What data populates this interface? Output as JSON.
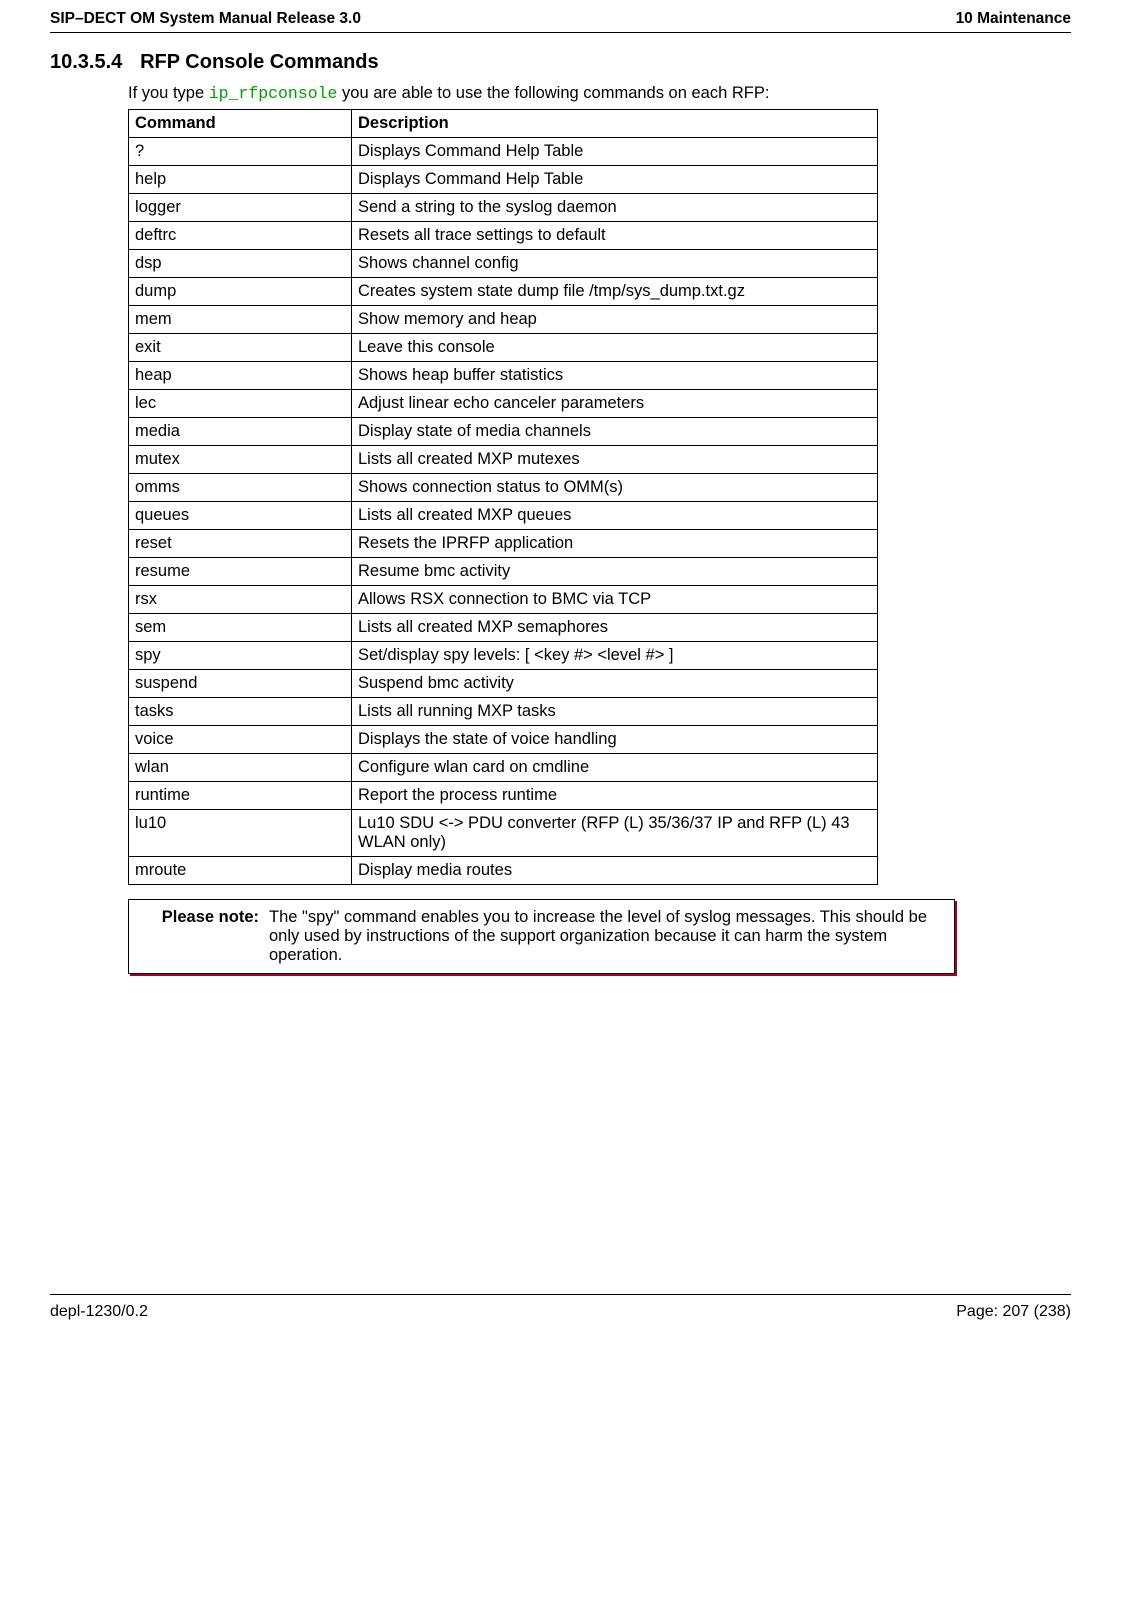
{
  "header": {
    "left": "SIP–DECT OM System Manual Release 3.0",
    "right": "10 Maintenance"
  },
  "section": {
    "number": "10.3.5.4",
    "title": "RFP Console Commands"
  },
  "intro": {
    "prefix": "If you type ",
    "code": "ip_rfpconsole",
    "suffix": " you are able to use the following commands on each RFP:"
  },
  "table": {
    "headers": {
      "c1": "Command",
      "c2": "Description"
    },
    "rows": [
      {
        "cmd": "?",
        "desc": "Displays Command Help Table"
      },
      {
        "cmd": "help",
        "desc": "Displays Command Help Table"
      },
      {
        "cmd": "logger",
        "desc": "Send a string to the syslog daemon"
      },
      {
        "cmd": "deftrc",
        "desc": "Resets all trace settings to default"
      },
      {
        "cmd": "dsp",
        "desc": "Shows channel config"
      },
      {
        "cmd": "dump",
        "desc": "Creates system state dump file /tmp/sys_dump.txt.gz"
      },
      {
        "cmd": "mem",
        "desc": "Show memory and heap"
      },
      {
        "cmd": "exit",
        "desc": "Leave this console"
      },
      {
        "cmd": "heap",
        "desc": "Shows heap buffer statistics"
      },
      {
        "cmd": "lec",
        "desc": "Adjust linear echo canceler parameters"
      },
      {
        "cmd": "media",
        "desc": "Display state of media channels"
      },
      {
        "cmd": "mutex",
        "desc": "Lists all created MXP mutexes"
      },
      {
        "cmd": "omms",
        "desc": "Shows connection status to OMM(s)"
      },
      {
        "cmd": "queues",
        "desc": "Lists all created MXP queues"
      },
      {
        "cmd": "reset",
        "desc": "Resets the IPRFP application"
      },
      {
        "cmd": "resume",
        "desc": "Resume bmc activity"
      },
      {
        "cmd": "rsx",
        "desc": "Allows RSX connection to BMC via TCP"
      },
      {
        "cmd": "sem",
        "desc": "Lists all created MXP semaphores"
      },
      {
        "cmd": "spy",
        "desc": "Set/display spy levels: [ <key #> <level #> ]"
      },
      {
        "cmd": "suspend",
        "desc": "Suspend bmc activity"
      },
      {
        "cmd": "tasks",
        "desc": "Lists all running MXP tasks"
      },
      {
        "cmd": "voice",
        "desc": "Displays the state of voice handling"
      },
      {
        "cmd": "wlan",
        "desc": "Configure wlan card on cmdline"
      },
      {
        "cmd": "runtime",
        "desc": "Report the process runtime"
      },
      {
        "cmd": "lu10",
        "desc": "Lu10 SDU <-> PDU converter (RFP (L) 35/36/37 IP and RFP (L) 43 WLAN only)"
      },
      {
        "cmd": "mroute",
        "desc": "Display media routes"
      }
    ]
  },
  "note": {
    "label": "Please note:",
    "text": "The \"spy\" command enables you to increase the level of syslog messages. This should be only used by instructions of the support organization because it can harm the system operation."
  },
  "footer": {
    "left": "depl-1230/0.2",
    "right": "Page: 207 (238)"
  }
}
